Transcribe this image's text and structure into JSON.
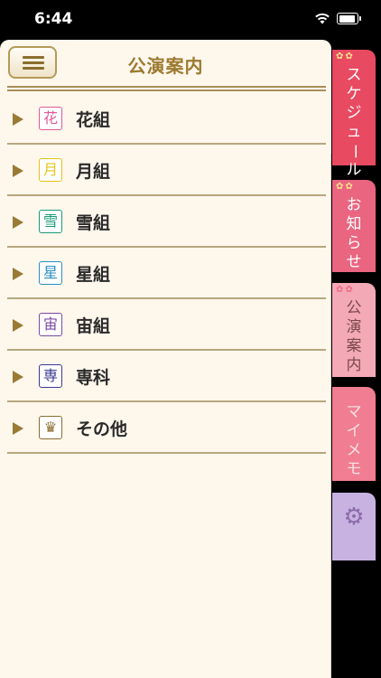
{
  "status_bar": {
    "time": "6:44"
  },
  "header": {
    "title": "公演案内"
  },
  "troupes": [
    {
      "label": "花組",
      "emblem": "花",
      "color": "#e0589a"
    },
    {
      "label": "月組",
      "emblem": "月",
      "color": "#e7c21b"
    },
    {
      "label": "雪組",
      "emblem": "雪",
      "color": "#1a9a78"
    },
    {
      "label": "星組",
      "emblem": "星",
      "color": "#2a8fbf"
    },
    {
      "label": "宙組",
      "emblem": "宙",
      "color": "#7b4aa3"
    },
    {
      "label": "専科",
      "emblem": "専",
      "color": "#3b3a8f"
    },
    {
      "label": "その他",
      "emblem": "♛",
      "color": "#8a6d2e"
    }
  ],
  "side_tabs": {
    "schedule": "スケジュール",
    "news": "お知らせ",
    "performance": "公演案内",
    "memo": "マイメモ",
    "settings_icon": "gear-icon"
  }
}
